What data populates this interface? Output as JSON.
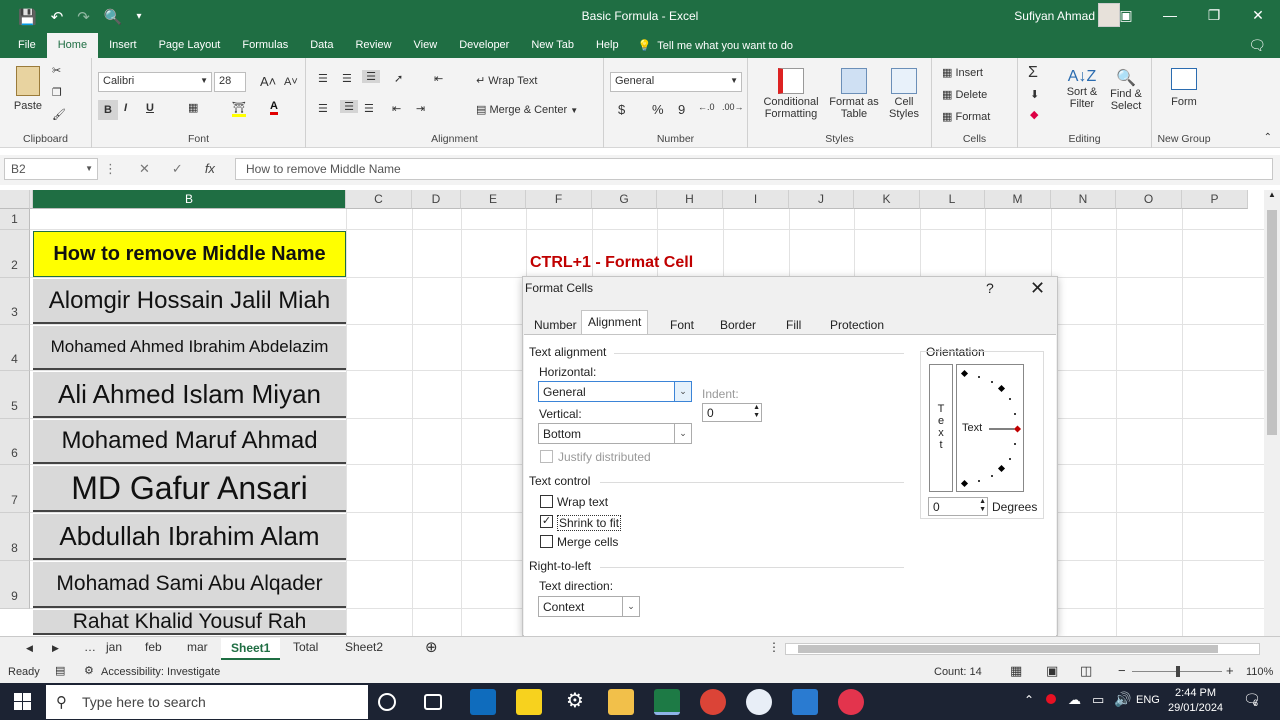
{
  "titlebar": {
    "title": "Basic Formula - Excel",
    "user": "Sufiyan Ahmad"
  },
  "menu": {
    "tabs": [
      "File",
      "Home",
      "Insert",
      "Page Layout",
      "Formulas",
      "Data",
      "Review",
      "View",
      "Developer",
      "New Tab",
      "Help"
    ],
    "active": "Home",
    "tell_me": "Tell me what you want to do"
  },
  "ribbon": {
    "clipboard": {
      "paste": "Paste",
      "label": "Clipboard"
    },
    "font": {
      "name": "Calibri",
      "size": "28",
      "bold": "B",
      "italic": "I",
      "underline": "U",
      "label": "Font"
    },
    "alignment": {
      "wrap_text": "Wrap Text",
      "merge_center": "Merge & Center",
      "label": "Alignment"
    },
    "number": {
      "format": "General",
      "currency": "$",
      "percent": "%",
      "comma": "9",
      "label": "Number"
    },
    "styles": {
      "conditional": "Conditional",
      "conditional2": "Formatting",
      "format_as": "Format as",
      "format_as2": "Table",
      "cell_styles": "Cell",
      "cell_styles2": "Styles",
      "label": "Styles"
    },
    "cells": {
      "insert": "Insert",
      "delete": "Delete",
      "format": "Format",
      "label": "Cells"
    },
    "editing": {
      "sort": "Sort &",
      "sort2": "Filter",
      "find": "Find &",
      "find2": "Select",
      "label": "Editing"
    },
    "newgroup": {
      "form": "Form",
      "label": "New Group"
    }
  },
  "formula_bar": {
    "name_box": "B2",
    "fx": "fx",
    "content": "How to remove Middle Name"
  },
  "grid": {
    "columns": [
      "B",
      "C",
      "D",
      "E",
      "F",
      "G",
      "H",
      "I",
      "J",
      "K",
      "L",
      "M",
      "N",
      "O",
      "P"
    ],
    "rows": [
      "1",
      "2",
      "3",
      "4",
      "5",
      "6",
      "7",
      "8",
      "9"
    ],
    "cells_b": [
      "How to remove Middle Name",
      "Alomgir Hossain Jalil Miah",
      "Mohamed Ahmed Ibrahim Abdelazim",
      "Ali Ahmed Islam Miyan",
      "Mohamed Maruf Ahmad",
      "MD Gafur Ansari",
      "Abdullah Ibrahim Alam",
      "Mohamad Sami Abu Alqader",
      "Rahat Khalid Yousuf Rah"
    ],
    "note": "CTRL+1 - Format Cell"
  },
  "sheets": {
    "tabs": [
      "jan",
      "feb",
      "mar",
      "Sheet1",
      "Total",
      "Sheet2"
    ],
    "active": "Sheet1"
  },
  "status": {
    "ready": "Ready",
    "accessibility": "Accessibility: Investigate",
    "count": "Count: 14",
    "zoom": "110%"
  },
  "taskbar": {
    "search_placeholder": "Type here to search",
    "lang": "ENG",
    "time": "2:44 PM",
    "date": "29/01/2024",
    "notifications": "6"
  },
  "dialog": {
    "title": "Format Cells",
    "help": "?",
    "tabs": [
      "Number",
      "Alignment",
      "Font",
      "Border",
      "Fill",
      "Protection"
    ],
    "active_tab": "Alignment",
    "text_alignment": "Text alignment",
    "horizontal_label": "Horizontal:",
    "horizontal_value": "General",
    "indent_label": "Indent:",
    "indent_value": "0",
    "vertical_label": "Vertical:",
    "vertical_value": "Bottom",
    "justify_distributed": "Justify distributed",
    "text_control": "Text control",
    "wrap_text": "Wrap text",
    "wrap_checked": false,
    "shrink_to_fit": "Shrink to fit",
    "shrink_checked": true,
    "merge_cells": "Merge cells",
    "merge_checked": false,
    "rtl": "Right-to-left",
    "text_direction_label": "Text direction:",
    "text_direction_value": "Context",
    "orientation": "Orientation",
    "orientation_text": "Text",
    "vertical_text": [
      "T",
      "e",
      "x",
      "t"
    ],
    "degrees_value": "0",
    "degrees_label": "Degrees"
  },
  "colors": {
    "excel_green": "#1f6e43",
    "header_fill": "#ffff00",
    "cell_fill": "#d9d9d9",
    "note_red": "#c00000"
  }
}
